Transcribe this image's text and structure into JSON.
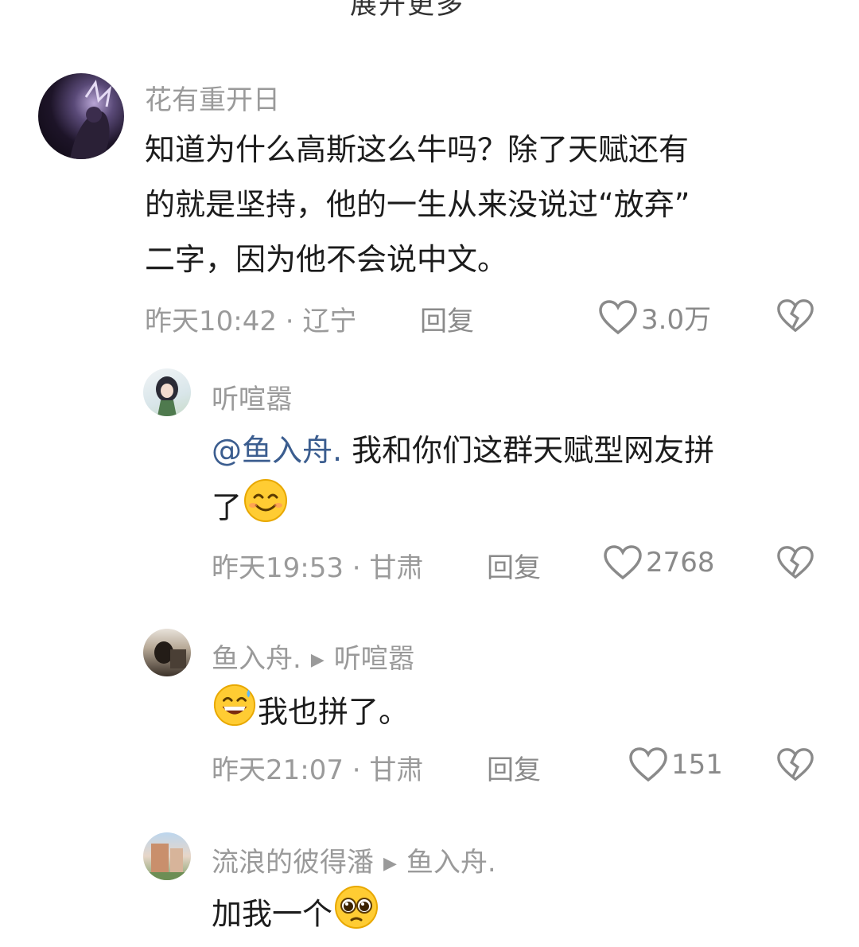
{
  "top_partial_text": "展开更多",
  "comments": [
    {
      "username": "花有重开日",
      "text": "知道为什么高斯这么牛吗？除了天赋还有的就是坚持，他的一生从来没说过“放弃”二字，因为他不会说中文。",
      "line1": "知道为什么高斯这么牛吗？除了天赋还有",
      "line2": "的就是坚持，他的一生从来没说过“放弃”",
      "line3": "二字，因为他不会说中文。",
      "meta": "昨天10:42 · 辽宁",
      "reply_label": "回复",
      "likes": "3.0万"
    },
    {
      "username": "听喧嚣",
      "mention": "@鱼入舟.",
      "line1": " 我和你们这群天赋型网友拼",
      "line2": "了",
      "emoji": "smiling-face-emoji",
      "meta": "昨天19:53 · 甘肃",
      "reply_label": "回复",
      "likes": "2768"
    },
    {
      "username": "鱼入舟.",
      "reply_to": "听喧嚣",
      "emoji": "grinning-sweat-emoji",
      "text": "我也拼了。",
      "meta": "昨天21:07 · 甘肃",
      "reply_label": "回复",
      "likes": "151"
    },
    {
      "username": "流浪的彼得潘",
      "reply_to": "鱼入舟.",
      "text": "加我一个",
      "emoji": "pleading-face-emoji"
    }
  ],
  "colors": {
    "name_gray": "#9a9a9a",
    "mention_blue": "#3b5d8f",
    "text": "#1c1c1c"
  }
}
